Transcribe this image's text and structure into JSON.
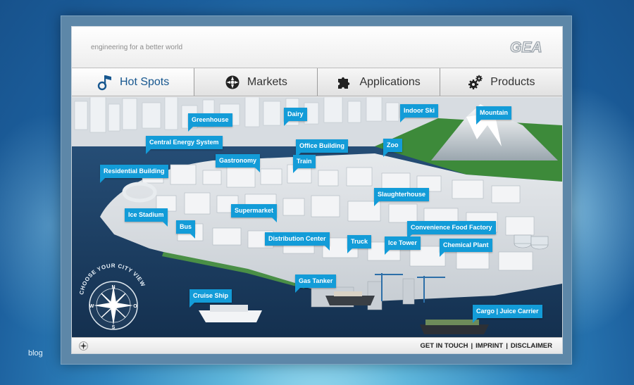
{
  "outside_label": "blog",
  "header": {
    "slogan": "engineering for a better world",
    "logo_text": "GEA"
  },
  "nav": {
    "tabs": [
      {
        "label": "Hot Spots",
        "icon": "hotspot-icon",
        "active": true
      },
      {
        "label": "Markets",
        "icon": "markets-icon",
        "active": false
      },
      {
        "label": "Applications",
        "icon": "puzzle-icon",
        "active": false
      },
      {
        "label": "Products",
        "icon": "gears-icon",
        "active": false
      }
    ]
  },
  "hotspots": {
    "greenhouse": "Greenhouse",
    "dairy": "Dairy",
    "indoor_ski": "Indoor Ski",
    "mountain": "Mountain",
    "central_energy": "Central Energy System",
    "office_building": "Office Building",
    "zoo": "Zoo",
    "gastronomy": "Gastronomy",
    "train": "Train",
    "residential": "Residential Building",
    "slaughterhouse": "Slaughterhouse",
    "supermarket": "Supermarket",
    "ice_stadium": "Ice Stadium",
    "bus": "Bus",
    "convenience_food": "Convenience Food Factory",
    "distribution_center": "Distribution Center",
    "truck": "Truck",
    "ice_tower": "Ice Tower",
    "chemical_plant": "Chemical Plant",
    "gas_tanker": "Gas Tanker",
    "cruise_ship": "Cruise Ship",
    "cargo_carrier": "Cargo | Juice Carrier"
  },
  "compass": {
    "caption": "CHOOSE YOUR CITY VIEW",
    "n": "N",
    "s": "S",
    "w": "W",
    "o": "O"
  },
  "footer": {
    "get_in_touch": "GET IN TOUCH",
    "sep1": "|",
    "imprint": "IMPRINT",
    "sep2": "|",
    "disclaimer": "DISCLAIMER"
  },
  "colors": {
    "hotspot_bg": "#139cd8",
    "active_tab_text": "#17578f",
    "water": "#1a3a5e"
  }
}
